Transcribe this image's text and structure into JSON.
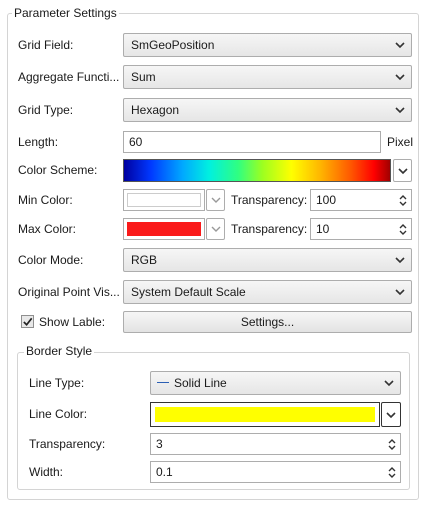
{
  "group": {
    "title": "Parameter Settings"
  },
  "fields": {
    "grid_field": {
      "label": "Grid Field:",
      "value": "SmGeoPosition"
    },
    "aggregate_function": {
      "label": "Aggregate Functi...",
      "value": "Sum"
    },
    "grid_type": {
      "label": "Grid Type:",
      "value": "Hexagon"
    },
    "length": {
      "label": "Length:",
      "value": "60",
      "unit": "Pixel"
    },
    "color_scheme": {
      "label": "Color Scheme:"
    },
    "min_color": {
      "label": "Min Color:",
      "color": "#ffffff",
      "transparency_label": "Transparency:",
      "transparency": "100"
    },
    "max_color": {
      "label": "Max Color:",
      "color": "#fa1a1a",
      "transparency_label": "Transparency:",
      "transparency": "10"
    },
    "color_mode": {
      "label": "Color Mode:",
      "value": "RGB"
    },
    "original_point": {
      "label": "Original Point Vis...",
      "value": "System Default Scale"
    },
    "show_label": {
      "label": "Show Lable:",
      "checked": true,
      "settings_button": "Settings..."
    }
  },
  "border_style": {
    "title": "Border Style",
    "line_type": {
      "label": "Line Type:",
      "value": "Solid Line"
    },
    "line_color": {
      "label": "Line Color:",
      "color": "#ffff00"
    },
    "transparency": {
      "label": "Transparency:",
      "value": "3"
    },
    "width": {
      "label": "Width:",
      "value": "0.1"
    }
  }
}
